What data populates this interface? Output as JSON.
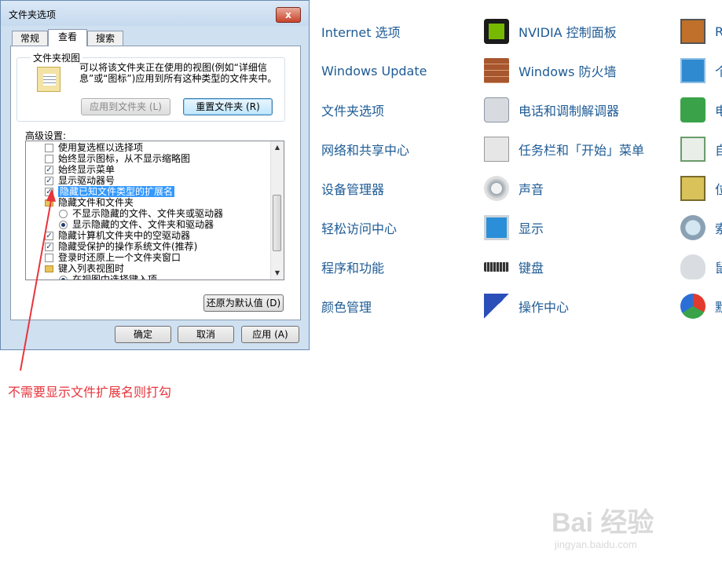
{
  "dialog": {
    "title": "文件夹选项",
    "close_label": "x",
    "tabs": [
      "常规",
      "查看",
      "搜索"
    ],
    "group_title": "文件夹视图",
    "group_desc": "可以将该文件夹正在使用的视图(例如“详细信息”或“图标”)应用到所有这种类型的文件夹中。",
    "apply_folders": "应用到文件夹 (L)",
    "reset_folders": "重置文件夹 (R)",
    "advanced_label": "高级设置:",
    "settings": [
      {
        "type": "checkbox",
        "label": "使用复选框以选择项",
        "checked": false
      },
      {
        "type": "checkbox",
        "label": "始终显示图标，从不显示缩略图",
        "checked": false
      },
      {
        "type": "checkbox",
        "label": "始终显示菜单",
        "checked": true
      },
      {
        "type": "checkbox",
        "label": "显示驱动器号",
        "checked": true
      },
      {
        "type": "checkbox",
        "label": "隐藏已知文件类型的扩展名",
        "checked": true
      },
      {
        "type": "folder",
        "label": "隐藏文件和文件夹"
      },
      {
        "type": "radio",
        "label": "不显示隐藏的文件、文件夹或驱动器",
        "checked": false
      },
      {
        "type": "radio",
        "label": "显示隐藏的文件、文件夹和驱动器",
        "checked": true
      },
      {
        "type": "checkbox",
        "label": "隐藏计算机文件夹中的空驱动器",
        "checked": true
      },
      {
        "type": "checkbox",
        "label": "隐藏受保护的操作系统文件(推荐)",
        "checked": true
      },
      {
        "type": "checkbox",
        "label": "登录时还原上一个文件夹窗口",
        "checked": false
      },
      {
        "type": "folder",
        "label": "键入列表视图时"
      },
      {
        "type": "radio",
        "label": "在视图中选择键入项",
        "checked": true
      }
    ],
    "restore_defaults": "还原为默认值 (D)",
    "ok": "确定",
    "cancel": "取消",
    "apply": "应用 (A)"
  },
  "control_panel": {
    "col1": [
      "Internet 选项",
      "Windows Update",
      "文件夹选项",
      "网络和共享中心",
      "设备管理器",
      "轻松访问中心",
      "程序和功能",
      "颜色管理"
    ],
    "col2": [
      "NVIDIA 控制面板",
      "Windows 防火墙",
      "电话和调制解调器",
      "任务栏和「开始」菜单",
      "声音",
      "显示",
      "键盘",
      "操作中心"
    ],
    "col3": [
      "R",
      "个",
      "电",
      "自",
      "位",
      "索",
      "鼠",
      "默"
    ]
  },
  "annotation": "不需要显示文件扩展名则打勾",
  "watermark": {
    "logo": "Bai 经验",
    "url": "jingyan.baidu.com"
  },
  "colors": {
    "link": "#1e5b95",
    "annotation": "#e8343b",
    "highlight": "#3399ff"
  }
}
